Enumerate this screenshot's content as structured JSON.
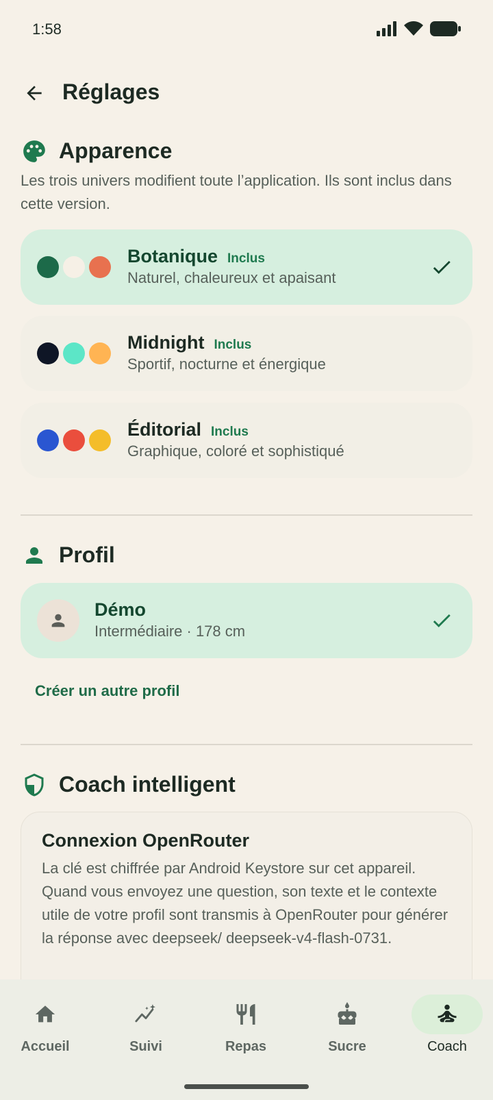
{
  "status_bar": {
    "time": "1:58"
  },
  "header": {
    "title": "Réglages"
  },
  "appearance": {
    "title": "Apparence",
    "description": "Les trois univers modifient toute l’application. Ils sont inclus dans cette version.",
    "themes": [
      {
        "name": "Botanique",
        "badge": "Inclus",
        "subtitle": "Naturel, chaleureux et apaisant",
        "selected": true,
        "colors": [
          "#1c6a49",
          "#f6f0e6",
          "#e8714f"
        ]
      },
      {
        "name": "Midnight",
        "badge": "Inclus",
        "subtitle": "Sportif, nocturne et énergique",
        "selected": false,
        "colors": [
          "#0f1626",
          "#5ce6c7",
          "#ffb453"
        ]
      },
      {
        "name": "Éditorial",
        "badge": "Inclus",
        "subtitle": "Graphique, coloré et sophistiqué",
        "selected": false,
        "colors": [
          "#2a56d1",
          "#ea4e3d",
          "#f4bd2a"
        ]
      }
    ]
  },
  "profile": {
    "title": "Profil",
    "card": {
      "name": "Démo",
      "subtitle": "Intermédiaire · 178 cm",
      "selected": true
    },
    "create_link": "Créer un autre profil"
  },
  "coach": {
    "title": "Coach intelligent",
    "card": {
      "title": "Connexion OpenRouter",
      "text": "La clé est chiffrée par Android Keystore sur cet appareil. Quand vous envoyez une question, son texte et le contexte utile de votre profil sont transmis à OpenRouter pour générer la réponse avec deepseek/ deepseek-v4-flash-0731."
    }
  },
  "nav": {
    "items": [
      {
        "label": "Accueil",
        "icon": "home-icon",
        "active": false
      },
      {
        "label": "Suivi",
        "icon": "trend-icon",
        "active": false
      },
      {
        "label": "Repas",
        "icon": "utensils-icon",
        "active": false
      },
      {
        "label": "Sucre",
        "icon": "cake-icon",
        "active": false
      },
      {
        "label": "Coach",
        "icon": "meditation-icon",
        "active": true
      }
    ]
  },
  "colors": {
    "accent": "#1f7a4f",
    "background": "#f6f1e8",
    "selected_card": "#d6efdf"
  }
}
